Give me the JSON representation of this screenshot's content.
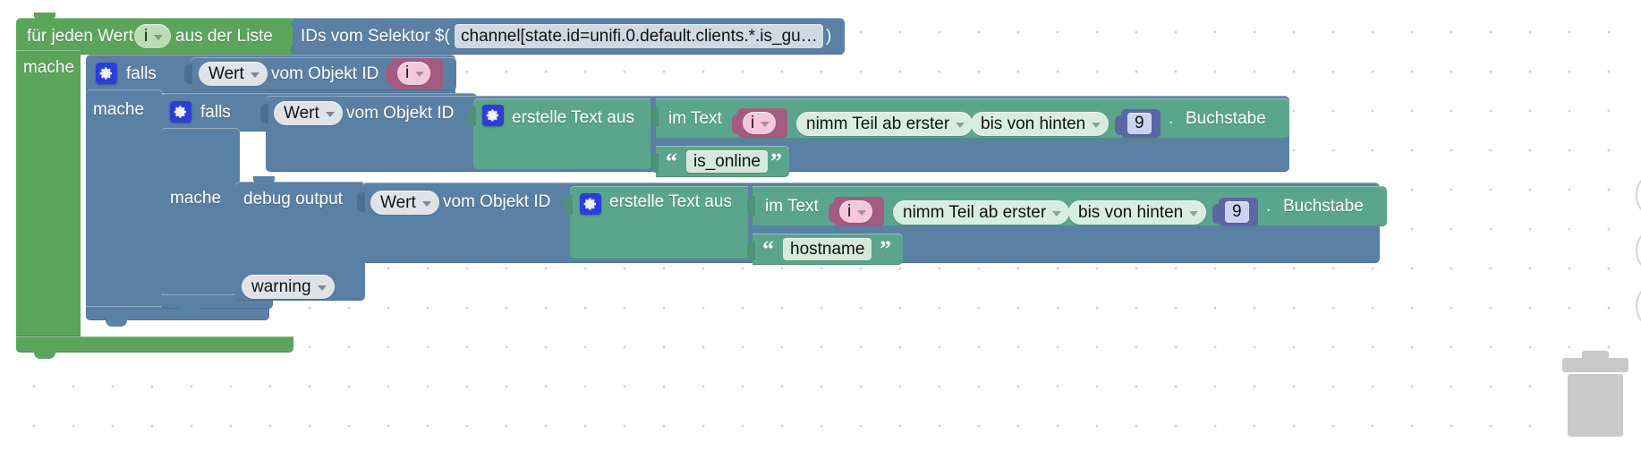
{
  "app": {
    "name": "blockly-workspace",
    "language": "de",
    "canvas_background": "#ffffff",
    "grid": "dotted"
  },
  "colors": {
    "loop_green": "#5ba55b",
    "control_blue": "#5b80a5",
    "text_green": "#5ba58c",
    "math_purple": "#5b67a5",
    "variable_pink": "#a55b80",
    "field_grey": "#dfe3e8"
  },
  "blocks": {
    "for_each": {
      "label_1": "für jeden Wert",
      "variable": "i",
      "label_2": "aus der Liste",
      "statement_label": "mache"
    },
    "selector": {
      "label": "IDs vom Selektor $(",
      "value": "channel[state.id=unifi.0.default.clients.*.is_gu…",
      "label_close": ")"
    },
    "if_outer": {
      "label": "falls",
      "mutator_icon": "gear-icon",
      "statement_label": "mache"
    },
    "get_object_outer": {
      "attribute": "Wert",
      "label": "vom Objekt ID",
      "object_id_variable": "i"
    },
    "if_inner": {
      "label": "falls",
      "mutator_icon": "gear-icon",
      "statement_label": "mache"
    },
    "get_object_inner": {
      "attribute": "Wert",
      "label": "vom Objekt ID"
    },
    "create_text_1": {
      "label": "erstelle Text aus",
      "mutator_icon": "gear-icon",
      "row_1": {
        "label_in_text": "im Text",
        "variable": "i",
        "mode_from": "nimm Teil ab erster",
        "mode_to": "bis von hinten",
        "number": "9",
        "label_dot": ".",
        "label_letter": "Buchstabe"
      },
      "row_2": {
        "quote_open": "“",
        "string": "is_online",
        "quote_close": "”"
      }
    },
    "debug_output": {
      "label": "debug output",
      "severity": "warning"
    },
    "get_object_debug": {
      "attribute": "Wert",
      "label": "vom Objekt ID"
    },
    "create_text_2": {
      "label": "erstelle Text aus",
      "mutator_icon": "gear-icon",
      "row_1": {
        "label_in_text": "im Text",
        "variable": "i",
        "mode_from": "nimm Teil ab erster",
        "mode_to": "bis von hinten",
        "number": "9",
        "label_dot": ".",
        "label_letter": "Buchstabe"
      },
      "row_2": {
        "quote_open": "“",
        "string": "hostname",
        "quote_close": "”"
      }
    }
  },
  "controls": {
    "center_icon": "target-crosshair-icon",
    "zoom_in_icon": "plus-icon",
    "zoom_out_icon": "minus-icon",
    "trash_icon": "trash-can-icon"
  }
}
